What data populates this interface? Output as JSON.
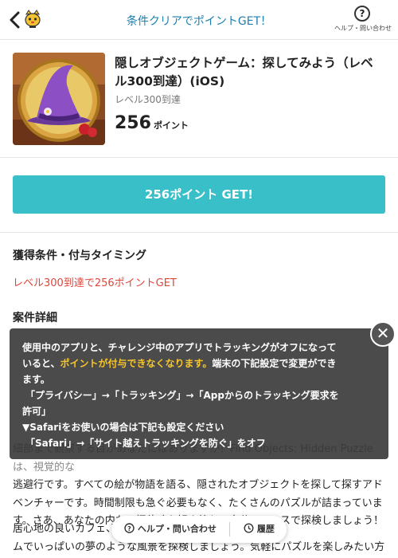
{
  "header": {
    "title": "条件クリアでポイントGET！",
    "help_icon_char": "?",
    "help_label": "ヘルプ・問い合わせ"
  },
  "product": {
    "title": "隠しオブジェクトゲーム：探してみよう（レベル300到達）(iOS)",
    "subtitle": "レベル300到達",
    "points": "256",
    "points_unit": "ポイント"
  },
  "cta": {
    "label": "256ポイント GET!"
  },
  "conditions": {
    "heading": "獲得条件・付与タイミング",
    "text": "レベル300到達で256ポイントGET"
  },
  "details": {
    "heading": "案件詳細",
    "line1": "細部まで観察する目があなたにはありますか？Find Objects: Hidden Puzzleは、視覚的な",
    "line2": "逃避行です。すべての絵が物語を語る、隠されたオブジェクトを探して探すアド",
    "line3": "ベンチャーです。時間制限も急ぐ必要もなく、たくさんのパズルが詰まっていま",
    "line4": "す。さあ、あなたの内なる探偵魂を解き放ち、自分のペースで探検しましょう！",
    "line5": "居心地の良いカフェ、、巧妙に隠されたアイテ",
    "line6": "ムでいっぱいの夢のような風景を探検しましょう。気軽にパズルを楽しみたい方"
  },
  "notice": {
    "line1a": "使用中のアプリと、チャレンジ中のアプリでトラッキングがオフになって",
    "line2a": "いると、",
    "line2_highlight": "ポイントが付与できなくなります。",
    "line2b": "端末の下記設定で変更ができ",
    "line3": "ます。",
    "line4": "「プライバシー」→「トラッキング」→「Appからのトラッキング要求を",
    "line5": "許可」",
    "line6": "▼Safariをお使いの場合は下記も設定ください",
    "line7": "「Safari」→「サイト越えトラッキングを防ぐ」をオフ",
    "close_char": "✕"
  },
  "bottom_bar": {
    "help_label": "ヘルプ・問い合わせ",
    "history_label": "履歴"
  },
  "colors": {
    "accent": "#39bfc8",
    "header_title": "#1c7fb0",
    "condition_red": "#e0453a",
    "highlight_yellow": "#f6c62b"
  }
}
